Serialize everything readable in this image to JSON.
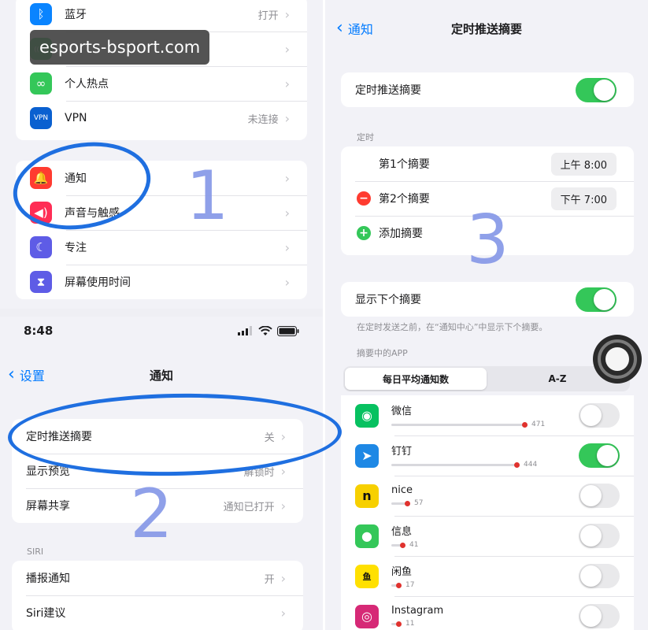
{
  "watermark": "esports-bsport.com",
  "panel1": {
    "group1": [
      {
        "label": "蓝牙",
        "value": "打开",
        "icon": "bluetooth-icon",
        "color": "#0a84ff"
      },
      {
        "label": "",
        "value": "",
        "icon": "antenna-icon",
        "color": "#34c759"
      },
      {
        "label": "个人热点",
        "value": "",
        "icon": "hotspot-icon",
        "color": "#34c759"
      },
      {
        "label": "VPN",
        "value": "未连接",
        "icon": "vpn-icon",
        "color": "#0a60d0"
      }
    ],
    "group2": [
      {
        "label": "通知",
        "value": "",
        "icon": "bell-icon",
        "color": "#ff3b30"
      },
      {
        "label": "声音与触感",
        "value": "",
        "icon": "speaker-icon",
        "color": "#ff2d55"
      },
      {
        "label": "专注",
        "value": "",
        "icon": "moon-icon",
        "color": "#5e5ce6"
      },
      {
        "label": "屏幕使用时间",
        "value": "",
        "icon": "hourglass-icon",
        "color": "#5e5ce6"
      }
    ],
    "annotation": "1"
  },
  "panel2": {
    "status_time": "8:48",
    "back_label": "设置",
    "title": "通知",
    "group1": [
      {
        "label": "定时推送摘要",
        "value": "关"
      },
      {
        "label": "显示预览",
        "value": "解锁时"
      },
      {
        "label": "屏幕共享",
        "value": "通知已打开"
      }
    ],
    "siri_label": "SIRI",
    "group2": [
      {
        "label": "播报通知",
        "value": "开"
      },
      {
        "label": "Siri建议",
        "value": ""
      }
    ],
    "annotation": "2"
  },
  "panel3": {
    "back_label": "通知",
    "title": "定时推送摘要",
    "main_toggle_label": "定时推送摘要",
    "main_toggle_on": true,
    "schedule_label": "定时",
    "schedule": [
      {
        "label": "第1个摘要",
        "time": "上午 8:00"
      },
      {
        "label": "第2个摘要",
        "time": "下午 7:00"
      }
    ],
    "add_label": "添加摘要",
    "next_label": "显示下个摘要",
    "next_on": true,
    "next_note": "在定时发送之前，在“通知中心”中显示下个摘要。",
    "apps_label": "摘要中的APP",
    "segments": [
      "每日平均通知数",
      "A-Z"
    ],
    "apps": [
      {
        "name": "微信",
        "count": "471",
        "value": 471,
        "on": false,
        "icon": "wechat-icon",
        "color": "#07c160",
        "glyph": "◉"
      },
      {
        "name": "钉钉",
        "count": "444",
        "value": 444,
        "on": true,
        "icon": "dingtalk-icon",
        "color": "#1e88e5",
        "glyph": "➤"
      },
      {
        "name": "nice",
        "count": "57",
        "value": 57,
        "on": false,
        "icon": "nice-icon",
        "color": "#f7d000",
        "glyph": "n"
      },
      {
        "name": "信息",
        "count": "41",
        "value": 41,
        "on": false,
        "icon": "messages-icon",
        "color": "#34c759",
        "glyph": "●"
      },
      {
        "name": "闲鱼",
        "count": "17",
        "value": 17,
        "on": false,
        "icon": "xianyu-icon",
        "color": "#ffe000",
        "glyph": "鱼"
      },
      {
        "name": "Instagram",
        "count": "11",
        "value": 11,
        "on": false,
        "icon": "instagram-icon",
        "color": "#d62976",
        "glyph": "◎"
      }
    ],
    "annotation": "3"
  }
}
